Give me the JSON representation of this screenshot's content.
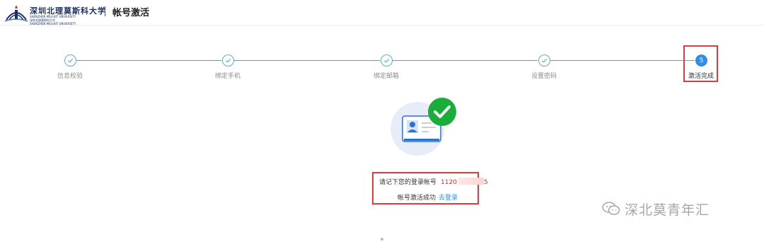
{
  "header": {
    "school_name": "深圳北理莫斯科大学",
    "school_name_en_line1": "SHENZHEN MSU-BIT UNIVERSITY",
    "school_name_en_line2": "深圳北理莫斯科大学",
    "school_name_en_line3": "SHENZHEN MSU-BIT UNIVERSITY",
    "page_title": "帐号激活"
  },
  "steps": [
    {
      "label": "信息校验",
      "status": "done"
    },
    {
      "label": "绑定手机",
      "status": "done"
    },
    {
      "label": "绑定邮箱",
      "status": "done"
    },
    {
      "label": "设置密码",
      "status": "done"
    },
    {
      "label": "激活完成",
      "status": "active",
      "number": "5"
    }
  ],
  "result": {
    "account_prompt": "请记下您的登录帐号",
    "account_value_prefix": "1120",
    "account_value_suffix": "5",
    "success_text": "帐号激活成功",
    "login_link": "去登录"
  },
  "watermark": {
    "text": "深北莫青年汇",
    "icon": "wechat-icon"
  },
  "colors": {
    "accent": "#2f8fe6",
    "success": "#1aad3b",
    "highlight": "#e03a3a",
    "account_red": "#e02a2a"
  }
}
